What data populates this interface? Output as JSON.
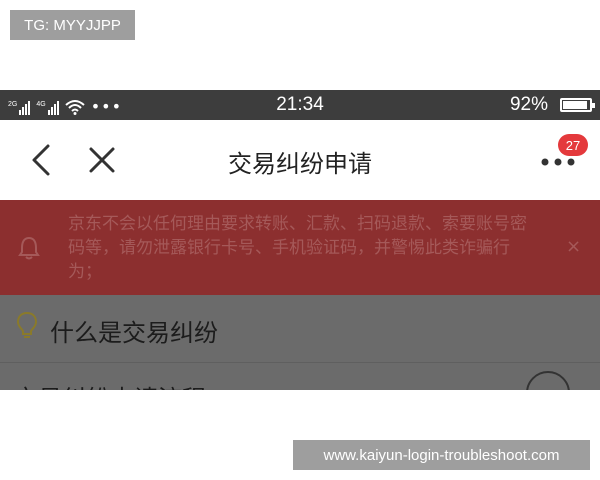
{
  "watermark_top": "TG: MYYJJPP",
  "watermark_bottom": "www.kaiyun-login-troubleshoot.com",
  "status_bar": {
    "network1": "2G",
    "network2": "4G",
    "overflow": "•••",
    "time": "21:34",
    "battery_pct": "92%",
    "battery_level": 0.92
  },
  "nav": {
    "title": "交易纠纷申请",
    "badge_count": "27",
    "icons": [
      "chevron-left-icon",
      "close-icon",
      "more-dots-icon"
    ]
  },
  "notice": {
    "text": "京东不会以任何理由要求转账、汇款、扫码退款、索要账号密码等，请勿泄露银行卡号、手机验证码，并警惕此类诈骗行为；",
    "close": "×",
    "icon": "bell-icon"
  },
  "faq": {
    "item1_title": "什么是交易纠纷",
    "item2_title": "交易纠纷申请流程",
    "icon": "lightbulb-icon"
  },
  "colors": {
    "status_bg": "#3d3d3d",
    "notice_bg": "#8c2f2f",
    "badge": "#e4393c",
    "overlay_content": "#6b6b6b"
  }
}
